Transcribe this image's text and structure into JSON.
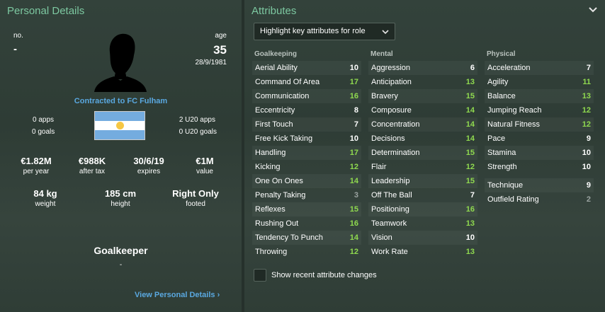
{
  "left": {
    "title": "Personal Details",
    "no_label": "no.",
    "no_value": "-",
    "age_label": "age",
    "age_value": "35",
    "dob": "28/9/1981",
    "contracted": "Contracted to FC Fulham",
    "apps": "0 apps",
    "goals": "0 goals",
    "u20_apps": "2 U20 apps",
    "u20_goals": "0 U20 goals",
    "wage": {
      "value": "€1.82M",
      "label": "per year"
    },
    "after_tax": {
      "value": "€988K",
      "label": "after tax"
    },
    "expires": {
      "value": "30/6/19",
      "label": "expires"
    },
    "player_value": {
      "value": "€1M",
      "label": "value"
    },
    "weight": {
      "value": "84 kg",
      "label": "weight"
    },
    "height": {
      "value": "185 cm",
      "label": "height"
    },
    "footed": {
      "value": "Right Only",
      "label": "footed"
    },
    "role": "Goalkeeper",
    "role_sub": "-",
    "view_link": "View Personal Details ›",
    "flag": {
      "colors": [
        "#74acdf",
        "#ffffff",
        "#74acdf"
      ],
      "sun": "#f6c744"
    }
  },
  "right": {
    "title": "Attributes",
    "highlight_label": "Highlight key attributes for role",
    "show_changes_label": "Show recent attribute changes",
    "columns": [
      {
        "heading": "Goalkeeping",
        "attrs": [
          {
            "name": "Aerial Ability",
            "value": "10",
            "tone": "white"
          },
          {
            "name": "Command Of Area",
            "value": "17",
            "tone": "green"
          },
          {
            "name": "Communication",
            "value": "16",
            "tone": "green"
          },
          {
            "name": "Eccentricity",
            "value": "8",
            "tone": "white"
          },
          {
            "name": "First Touch",
            "value": "7",
            "tone": "white"
          },
          {
            "name": "Free Kick Taking",
            "value": "10",
            "tone": "white"
          },
          {
            "name": "Handling",
            "value": "17",
            "tone": "green"
          },
          {
            "name": "Kicking",
            "value": "12",
            "tone": "green"
          },
          {
            "name": "One On Ones",
            "value": "14",
            "tone": "green"
          },
          {
            "name": "Penalty Taking",
            "value": "3",
            "tone": "grey"
          },
          {
            "name": "Reflexes",
            "value": "15",
            "tone": "green"
          },
          {
            "name": "Rushing Out",
            "value": "16",
            "tone": "green"
          },
          {
            "name": "Tendency To Punch",
            "value": "14",
            "tone": "green"
          },
          {
            "name": "Throwing",
            "value": "12",
            "tone": "green"
          }
        ]
      },
      {
        "heading": "Mental",
        "attrs": [
          {
            "name": "Aggression",
            "value": "6",
            "tone": "white"
          },
          {
            "name": "Anticipation",
            "value": "13",
            "tone": "green"
          },
          {
            "name": "Bravery",
            "value": "15",
            "tone": "green"
          },
          {
            "name": "Composure",
            "value": "14",
            "tone": "green"
          },
          {
            "name": "Concentration",
            "value": "14",
            "tone": "green"
          },
          {
            "name": "Decisions",
            "value": "14",
            "tone": "green"
          },
          {
            "name": "Determination",
            "value": "15",
            "tone": "green"
          },
          {
            "name": "Flair",
            "value": "12",
            "tone": "green"
          },
          {
            "name": "Leadership",
            "value": "15",
            "tone": "green"
          },
          {
            "name": "Off The Ball",
            "value": "7",
            "tone": "white"
          },
          {
            "name": "Positioning",
            "value": "16",
            "tone": "green"
          },
          {
            "name": "Teamwork",
            "value": "13",
            "tone": "green"
          },
          {
            "name": "Vision",
            "value": "10",
            "tone": "white"
          },
          {
            "name": "Work Rate",
            "value": "13",
            "tone": "green"
          }
        ]
      },
      {
        "heading": "Physical",
        "attrs": [
          {
            "name": "Acceleration",
            "value": "7",
            "tone": "white"
          },
          {
            "name": "Agility",
            "value": "11",
            "tone": "green"
          },
          {
            "name": "Balance",
            "value": "13",
            "tone": "green"
          },
          {
            "name": "Jumping Reach",
            "value": "12",
            "tone": "green"
          },
          {
            "name": "Natural Fitness",
            "value": "12",
            "tone": "green"
          },
          {
            "name": "Pace",
            "value": "9",
            "tone": "white"
          },
          {
            "name": "Stamina",
            "value": "10",
            "tone": "white"
          },
          {
            "name": "Strength",
            "value": "10",
            "tone": "white"
          }
        ]
      }
    ],
    "extra": [
      {
        "name": "Technique",
        "value": "9",
        "tone": "white"
      },
      {
        "name": "Outfield Rating",
        "value": "2",
        "tone": "grey"
      }
    ]
  }
}
